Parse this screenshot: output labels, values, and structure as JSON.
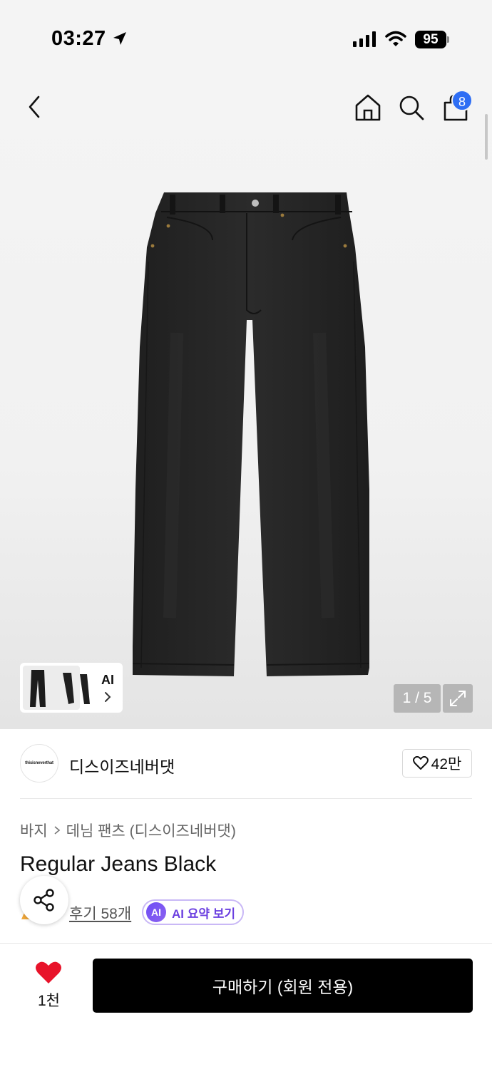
{
  "status_bar": {
    "time": "03:27",
    "battery": "95",
    "icons": [
      "location-arrow-icon",
      "cellular-signal-icon",
      "wifi-icon",
      "battery-icon"
    ]
  },
  "header": {
    "cart_count": "8",
    "icons": [
      "back-chevron-icon",
      "home-icon",
      "search-icon",
      "shopping-bag-icon"
    ]
  },
  "gallery": {
    "counter": "1 / 5",
    "ai_thumb_label": "AI",
    "background_color": "#f1f1f1"
  },
  "brand": {
    "logo_text": "thisisneverthat",
    "name": "디스이즈네버댓",
    "likes": "42만"
  },
  "breadcrumb": {
    "items": [
      "바지",
      "데님 팬츠 (디스이즈네버댓)"
    ]
  },
  "product": {
    "title": "Regular Jeans Black",
    "reviews": "후기 58개",
    "ai_badge": "AI",
    "ai_summary": "AI 요약 보기"
  },
  "bottom_bar": {
    "like_count": "1천",
    "buy_label": "구매하기 (회원 전용)",
    "heart_color": "#e8132a",
    "button_color": "#000000"
  },
  "colors": {
    "accent_blue": "#2e6ef4",
    "ai_purple": "#6b3fe0"
  }
}
